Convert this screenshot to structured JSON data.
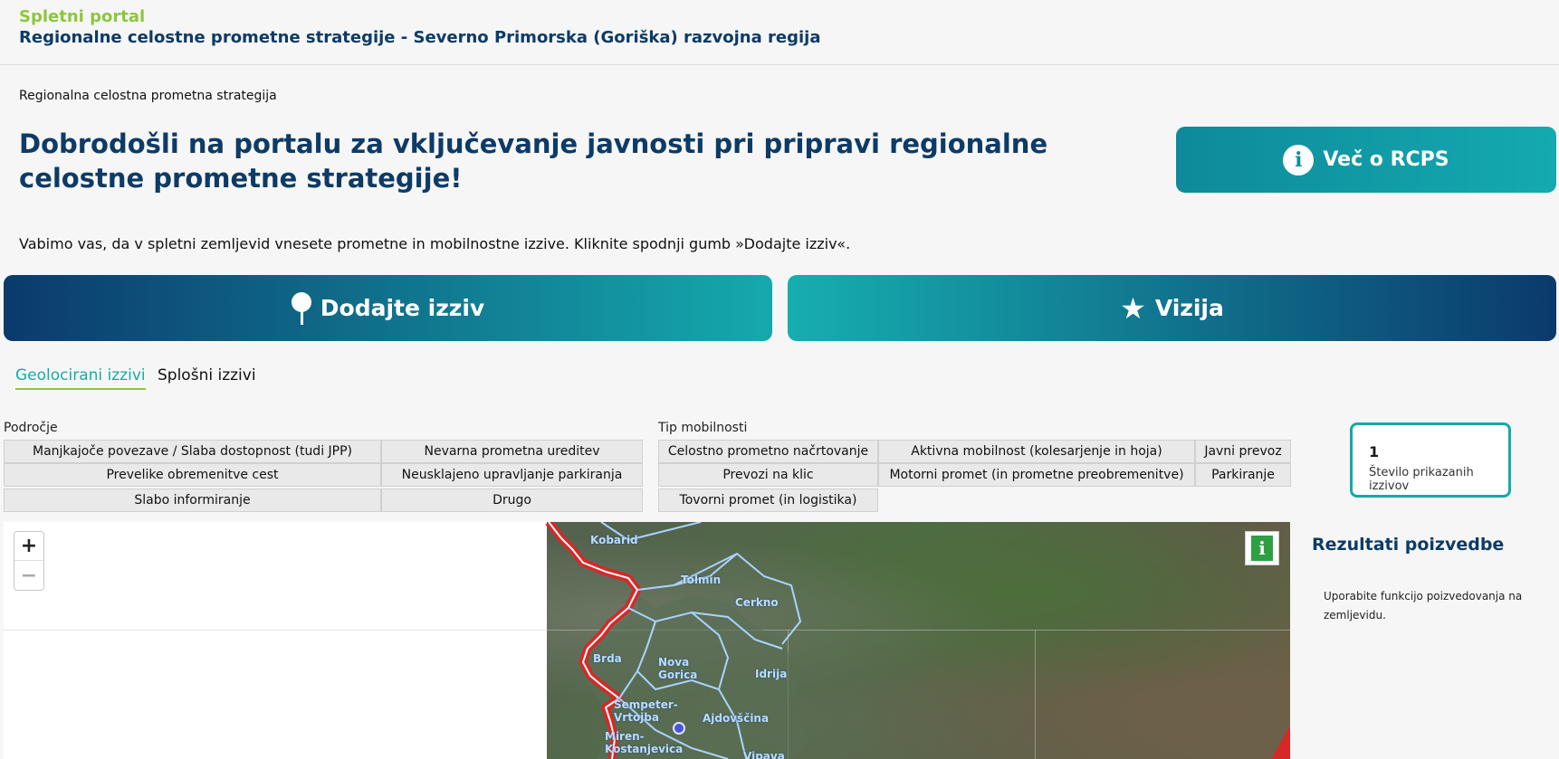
{
  "header": {
    "portal_label": "Spletni portal",
    "portal_title": "Regionalne celostne prometne strategije - Severno Primorska (Goriška) razvojna regija"
  },
  "breadcrumb": "Regionalna celostna prometna strategija",
  "hero": {
    "title": "Dobrodošli na portalu za vključevanje javnosti pri pripravi regionalne celostne prometne strategije!",
    "more_button": "Več o RCPS"
  },
  "intro_text": "Vabimo vas, da v spletni zemljevid vnesete prometne in mobilnostne izzive. Kliknite spodnji gumb »Dodajte izziv«.",
  "actions": {
    "add_challenge": "Dodajte izziv",
    "vision": "Vizija"
  },
  "tabs": [
    {
      "label": "Geolocirani izzivi",
      "active": true
    },
    {
      "label": "Splošni izzivi",
      "active": false
    }
  ],
  "filters": {
    "area": {
      "label": "Področje",
      "options": [
        "Manjkajoče povezave / Slaba dostopnost (tudi JPP)",
        "Nevarna prometna ureditev",
        "Prevelike obremenitve cest",
        "Neusklajeno upravljanje parkiranja",
        "Slabo informiranje",
        "Drugo"
      ]
    },
    "mobility": {
      "label": "Tip mobilnosti",
      "options": [
        "Celostno prometno načrtovanje",
        "Aktivna mobilnost (kolesarjenje in hoja)",
        "Javni prevoz",
        "Prevozi na klic",
        "Motorni promet (in prometne preobremenitve)",
        "Parkiranje",
        "Tovorni promet (in logistika)"
      ]
    }
  },
  "count": {
    "value": "1",
    "label": "Število prikazanih izzivov"
  },
  "map": {
    "zoom_in": "+",
    "zoom_out": "−",
    "info": "i",
    "places": [
      "Kobarid",
      "Tolmin",
      "Cerkno",
      "Brda",
      "Nova Gorica",
      "Idrija",
      "Šempeter-Vrtojba",
      "Ajdovščina",
      "Miren-Kostanjevica",
      "Vipava"
    ]
  },
  "results": {
    "title": "Rezultati poizvedbe",
    "text": "Uporabite funkcijo poizvedovanja na zemljevidu."
  },
  "colors": {
    "brand_dark": "#0d3b66",
    "brand_teal": "#15a9ad",
    "accent_green": "#8dc63f",
    "border_red": "#d62828"
  }
}
